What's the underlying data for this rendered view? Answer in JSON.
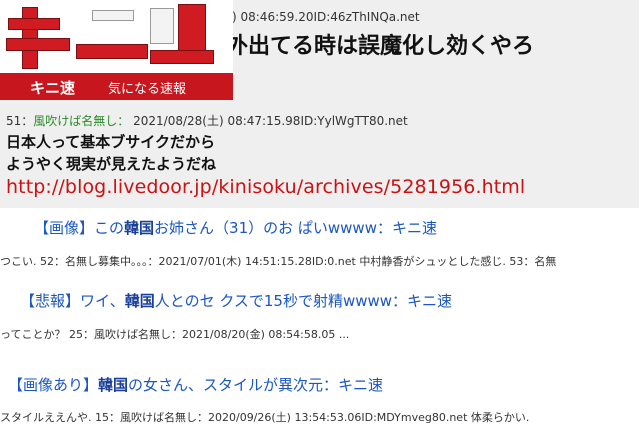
{
  "logo": {
    "name": "キニ速",
    "tagline": "気になる速報"
  },
  "post_top": {
    "header": ") 08:46:59.20ID:46zThINQa.net",
    "title": "外出てる時は誤魔化し効くやろ"
  },
  "post_51": {
    "number": "51：",
    "name": "風吹けば名無し：",
    "datetime": "2021/08/28(土) 08:47:15.98ID:YylWgTT80.net",
    "line1": "日本人って基本ブサイクだから",
    "line2": "ようやく現実が見えたようだね"
  },
  "source_link": "http://blog.livedoor.jp/kinisoku/archives/5281956.html",
  "related": [
    {
      "prefix": "【画像】この",
      "keyword": "韓国",
      "suffix": "お姉さん（31）のお ぱいwwww：キニ速",
      "snippet": "つこい. 52：名無し募集中。。。：2021/07/01(木) 14:51:15.28ID:0.net 中村静香がシュッとした感じ. 53：名無"
    },
    {
      "prefix": "【悲報】ワイ、",
      "keyword": "韓国",
      "suffix": "人とのセ クスで15秒で射精wwww：キニ速",
      "snippet": "ってことか？ 25：風吹けば名無し：2021/08/20(金) 08:54:58.05 ..."
    },
    {
      "prefix": "【画像あり】",
      "keyword": "韓国",
      "suffix": "の女さん、スタイルが異次元：キニ速",
      "snippet": "スタイルええんや. 15：風吹けば名無し：2020/09/26(土) 13:54:53.06ID:MDYmveg80.net 体柔らかい."
    }
  ],
  "colors": {
    "logo_red": "#c8161e",
    "link_red": "#cc1111",
    "link_blue": "#1a56c4",
    "name_green": "#2a8a2a"
  }
}
